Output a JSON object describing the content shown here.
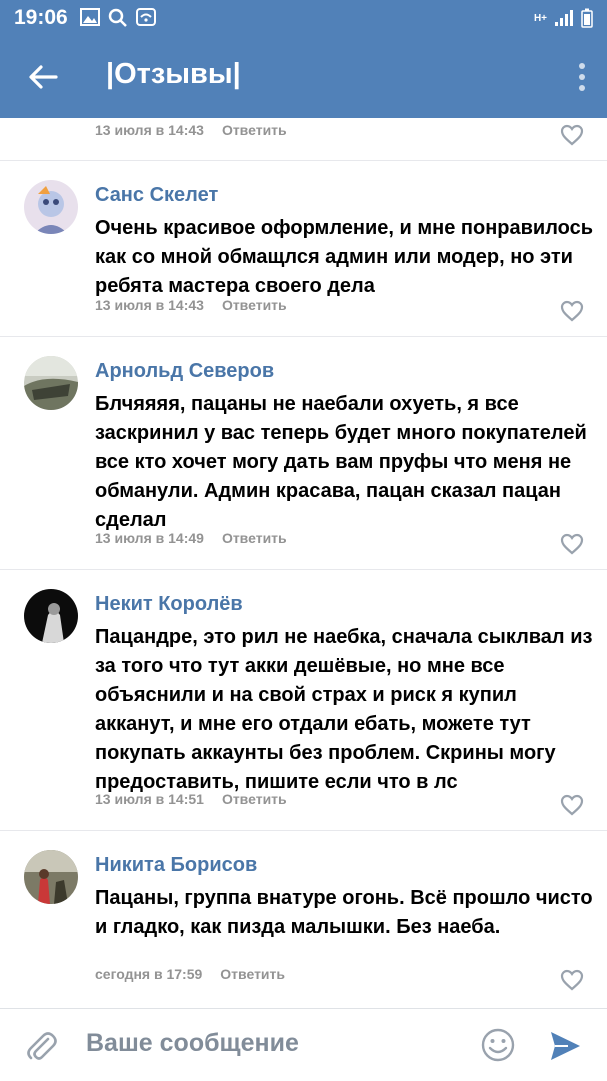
{
  "statusbar": {
    "time": "19:06",
    "network": "H+"
  },
  "header": {
    "title": "|Отзывы|"
  },
  "top_meta": {
    "date": "13 июля в 14:43",
    "reply": "Ответить"
  },
  "comments": [
    {
      "author": "Санс Скелет",
      "text": "Очень красивое оформление, и мне понравилось как со мной обмащлся админ или модер, но эти ребята мастера своего дела",
      "date": "13 июля в 14:43",
      "reply": "Ответить"
    },
    {
      "author": "Арнольд Северов",
      "text": "Блчяяяя, пацаны не наебали охуеть, я все заскринил у вас теперь будет много покупателей все кто хочет могу дать вам пруфы что меня не обманули. Админ красава, пацан сказал пацан сделал",
      "date": "13 июля в 14:49",
      "reply": "Ответить"
    },
    {
      "author": "Некит Королёв",
      "text": "Пацандре, это рил не наебка, сначала сыклвал из за того что тут акки дешёвые, но мне все объяснили и на свой страх и риск я купил акканут, и мне его отдали ебать, можете тут покупать аккаунты без проблем. Скрины могу предоставить, пишите если что в лс",
      "date": "13 июля в 14:51",
      "reply": "Ответить"
    },
    {
      "author": "Никита Борисов",
      "text": "Пацаны, группа внатуре огонь. Всё прошло чисто и гладко, как пизда малышки. Без наеба.",
      "date": "сегодня в 17:59",
      "reply": "Ответить"
    }
  ],
  "composer": {
    "placeholder": "Ваше сообщение"
  },
  "colors": {
    "header_bg": "#5181b8",
    "author": "#4a76a8",
    "send": "#5181b8"
  },
  "icons": [
    "back-arrow-icon",
    "more-vertical-icon",
    "heart-icon",
    "attach-icon",
    "emoji-icon",
    "send-icon"
  ]
}
